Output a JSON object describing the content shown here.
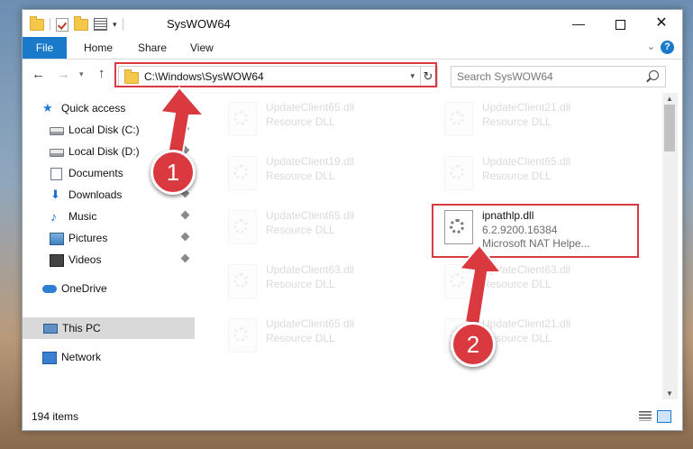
{
  "window": {
    "title": "SysWOW64"
  },
  "ribbon": {
    "tabs": [
      "File",
      "Home",
      "Share",
      "View"
    ]
  },
  "address": {
    "path": "C:\\Windows\\SysWOW64",
    "search_placeholder": "Search SysWOW64"
  },
  "sidebar": {
    "quick_access": "Quick access",
    "items": [
      {
        "label": "Local Disk (C:)",
        "icon": "disk-icon"
      },
      {
        "label": "Local Disk (D:)",
        "icon": "disk-icon"
      },
      {
        "label": "Documents",
        "icon": "documents-icon"
      },
      {
        "label": "Downloads",
        "icon": "downloads-icon"
      },
      {
        "label": "Music",
        "icon": "music-icon"
      },
      {
        "label": "Pictures",
        "icon": "pictures-icon"
      },
      {
        "label": "Videos",
        "icon": "videos-icon"
      }
    ],
    "onedrive": "OneDrive",
    "this_pc": "This PC",
    "network": "Network"
  },
  "files": [
    {
      "name": "UpdateClient65.dll",
      "desc": "Resource DLL"
    },
    {
      "name": "UpdateClient21.dll",
      "desc": "Resource DLL"
    },
    {
      "name": "UpdateClient19.dll",
      "desc": "Resource DLL"
    },
    {
      "name": "UpdateClient65.dll",
      "desc": "Resource DLL"
    },
    {
      "name": "UpdateClient65.dll",
      "desc": "Resource DLL"
    },
    {
      "name": "ipnathlp.dll",
      "version": "6.2.9200.16384",
      "desc": "Microsoft NAT Helpe..."
    },
    {
      "name": "UpdateClient63.dll",
      "desc": "Resource DLL"
    },
    {
      "name": "UpdateClient63.dll",
      "desc": "Resource DLL"
    },
    {
      "name": "UpdateClient65.dll",
      "desc": "Resource DLL"
    },
    {
      "name": "UpdateClient21.dll",
      "desc": "Resource DLL"
    }
  ],
  "status": {
    "count": "194 items"
  },
  "callouts": {
    "one": "1",
    "two": "2"
  },
  "colors": {
    "accent": "#1979ca",
    "highlight": "#d9393f"
  }
}
